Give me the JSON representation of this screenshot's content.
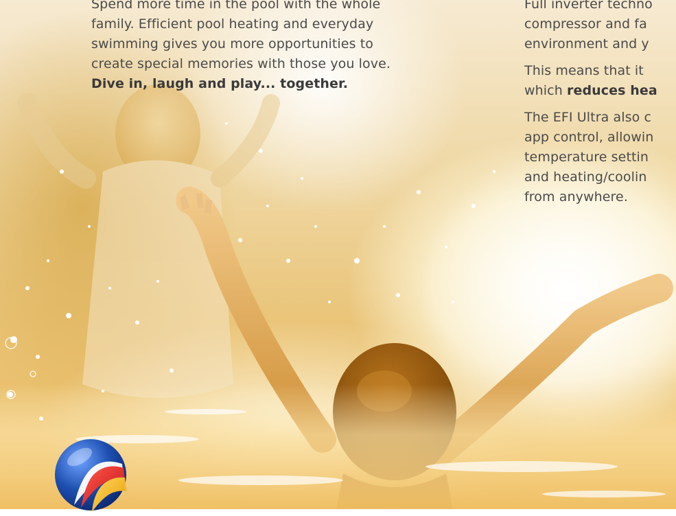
{
  "intro": {
    "lines": [
      "Spend more time in the pool with the whole",
      "family. Efficient pool heating and everyday",
      "swimming gives you more opportunities to",
      "create special memories with those you love."
    ],
    "tagline": "Dive in, laugh and play... together."
  },
  "features": {
    "p1_lines": [
      "Full inverter techno",
      "compressor and fa",
      "environment and y"
    ],
    "p2_line1": "This means that it",
    "p2_prefix": "which ",
    "p2_bold": "reduces hea",
    "p3_lines": [
      "The EFI Ultra also c",
      "app control, allowin",
      "temperature settin",
      "and heating/coolin",
      "from anywhere."
    ]
  },
  "colors": {
    "body_text": "#4a4a4a",
    "warm_glow": "#e9b85a",
    "logo_blue": "#1d4fb0",
    "logo_red": "#e0202a",
    "logo_yellow": "#f4b81c"
  },
  "logo": {
    "icon": "brand-globe-swirl-icon"
  }
}
